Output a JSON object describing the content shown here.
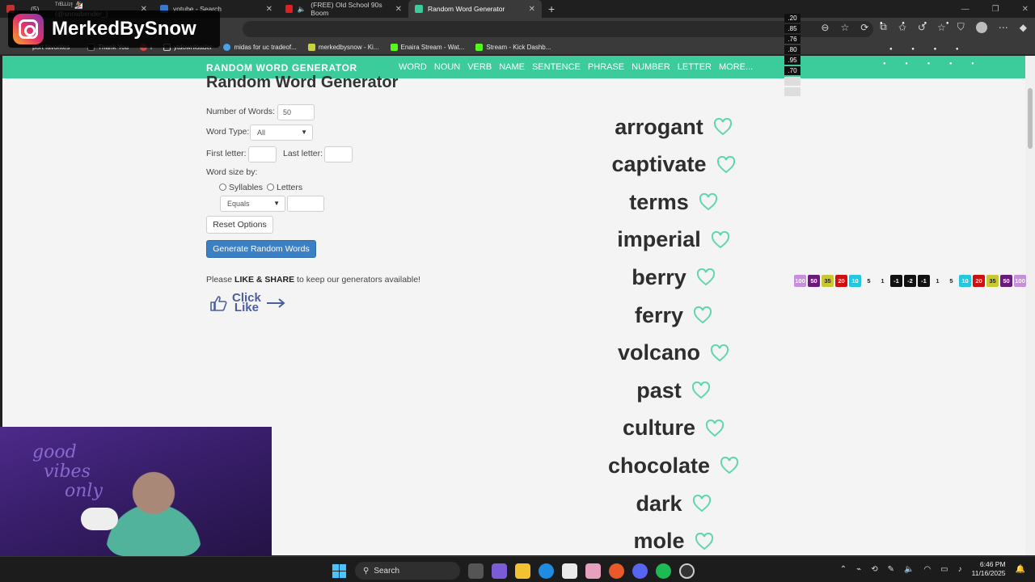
{
  "tabs": [
    {
      "label": "(5)",
      "active": false
    },
    {
      "label": "ᵀʳᴱᴸᴸᴵᶻ! 🏂 (@snowbender_)",
      "active": false
    },
    {
      "label": "yotube - Search",
      "active": false
    },
    {
      "label": "(FREE) Old School 90s Boom",
      "active": false
    },
    {
      "label": "Random Word Generator",
      "active": true
    }
  ],
  "bookmarks": [
    {
      "label": "port favorites"
    },
    {
      "label": "Thank You"
    },
    {
      "label": "i"
    },
    {
      "label": "ytdownloader"
    },
    {
      "label": "midas for uc tradeof..."
    },
    {
      "label": "merkedbysnow - Ki..."
    },
    {
      "label": "Enaira Stream - Wat..."
    },
    {
      "label": "Stream - Kick Dashb..."
    }
  ],
  "site": {
    "brand": "RANDOM WORD GENERATOR",
    "nav": [
      "WORD",
      "NOUN",
      "VERB",
      "NAME",
      "SENTENCE",
      "PHRASE",
      "NUMBER",
      "LETTER",
      "MORE..."
    ],
    "title": "Random Word Generator"
  },
  "form": {
    "num_words_label": "Number of Words:",
    "num_words_value": "50",
    "word_type_label": "Word Type:",
    "word_type_value": "All",
    "first_letter_label": "First letter:",
    "last_letter_label": "Last letter:",
    "word_size_label": "Word size by:",
    "syllables_label": "Syllables",
    "letters_label": "Letters",
    "size_compare_value": "Equals",
    "reset_label": "Reset Options",
    "generate_label": "Generate Random Words"
  },
  "like": {
    "prefix": "Please ",
    "bold": "LIKE & SHARE",
    "suffix": " to keep our generators available!",
    "click": "Click",
    "like": "Like"
  },
  "words": [
    "arrogant",
    "captivate",
    "terms",
    "imperial",
    "berry",
    "ferry",
    "volcano",
    "past",
    "culture",
    "chocolate",
    "dark",
    "mole"
  ],
  "overlay": {
    "ig_name": "MerkedBySnow",
    "odds": [
      ".20",
      ".85",
      ".76",
      ".80",
      ".95",
      ".70",
      "",
      ""
    ],
    "chips": [
      {
        "label": "100",
        "bg": "#c58fdc"
      },
      {
        "label": "50",
        "bg": "#6a1b7a"
      },
      {
        "label": "35",
        "bg": "#c8c832"
      },
      {
        "label": "20",
        "bg": "#d01010"
      },
      {
        "label": "10",
        "bg": "#27c6e0"
      },
      {
        "label": "5",
        "bg": "#f4f4f4"
      },
      {
        "label": "1",
        "bg": "#f4f4f4"
      },
      {
        "label": "-1",
        "bg": "#111111"
      },
      {
        "label": "-2",
        "bg": "#111111"
      },
      {
        "label": "-1",
        "bg": "#111111"
      },
      {
        "label": "1",
        "bg": "#f4f4f4"
      },
      {
        "label": "5",
        "bg": "#f4f4f4"
      },
      {
        "label": "10",
        "bg": "#27c6e0"
      },
      {
        "label": "20",
        "bg": "#d01010"
      },
      {
        "label": "35",
        "bg": "#c8c832"
      },
      {
        "label": "50",
        "bg": "#6a1b7a"
      },
      {
        "label": "100",
        "bg": "#c58fdc"
      }
    ],
    "neon_line1": "good",
    "neon_line2": "vibes",
    "neon_line3": "only"
  },
  "taskbar": {
    "search_label": "Search",
    "time": "6:46 PM",
    "date": "11/16/2025"
  },
  "colors": {
    "accent": "#3ccb9b",
    "button": "#3b80c4",
    "heart": "#5fd6b0"
  }
}
